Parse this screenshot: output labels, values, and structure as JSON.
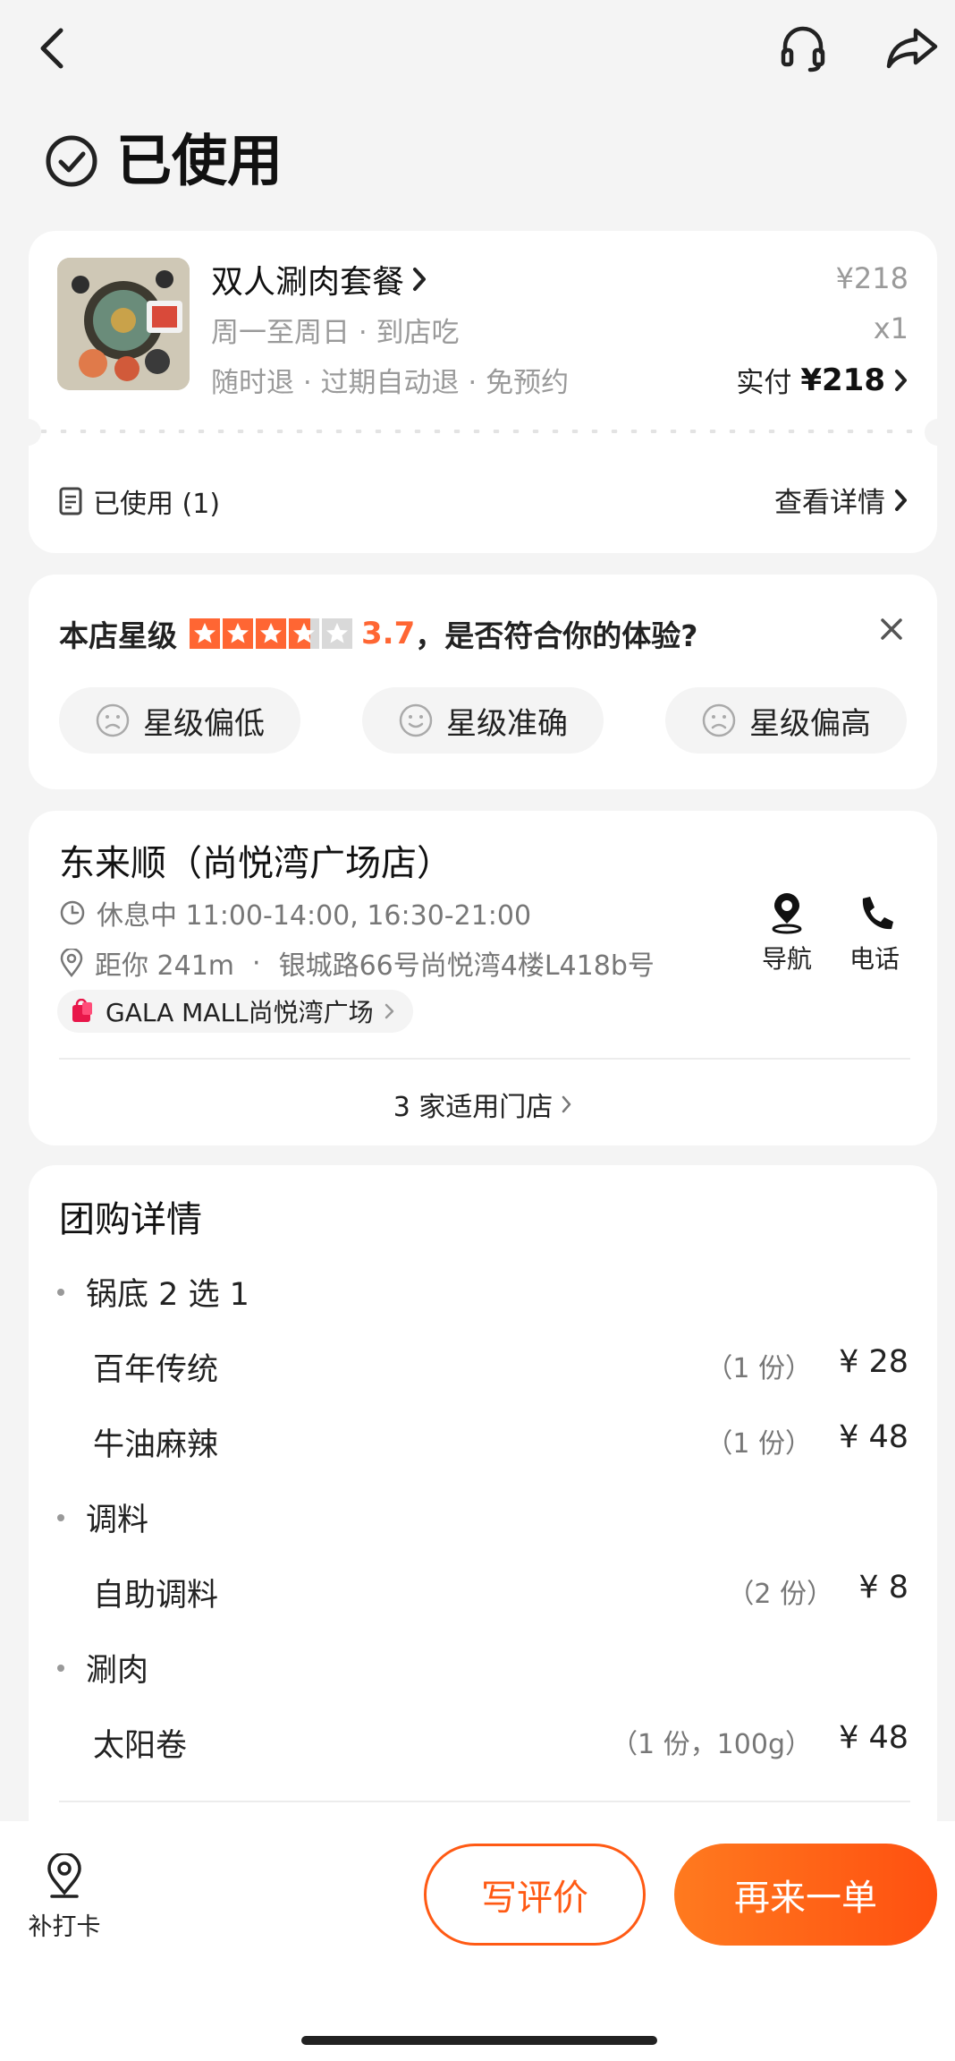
{
  "header": {
    "status_label": "已使用"
  },
  "order": {
    "title": "双人涮肉套餐",
    "subtitle": "周一至周日 · 到店吃",
    "policy": "随时退 · 过期自动退 · 免预约",
    "price": "¥218",
    "quantity": "x1",
    "paid_label": "实付",
    "paid_amount": "¥218",
    "voucher_status": "已使用 (1)",
    "view_details": "查看详情"
  },
  "rating": {
    "prefix": "本店星级",
    "score": "3.7",
    "stars_value": 3.7,
    "question": "，是否符合你的体验?",
    "options": [
      "星级偏低",
      "星级准确",
      "星级偏高"
    ]
  },
  "store": {
    "name": "东来顺（尚悦湾广场店）",
    "hours": "休息中 11:00-14:00, 16:30-21:00",
    "distance": "距你 241m",
    "address": "银城路66号尚悦湾4楼L418b号",
    "mall": "GALA MALL尚悦湾广场",
    "nav_label": "导航",
    "phone_label": "电话",
    "applicable_stores": "3 家适用门店"
  },
  "deal": {
    "title": "团购详情",
    "groups": [
      {
        "name": "锅底 2 选 1",
        "items": [
          {
            "name": "百年传统",
            "qty": "（1 份）",
            "price": "¥ 28"
          },
          {
            "name": "牛油麻辣",
            "qty": "（1 份）",
            "price": "¥ 48"
          }
        ]
      },
      {
        "name": "调料",
        "items": [
          {
            "name": "自助调料",
            "qty": "（2 份）",
            "price": "¥ 8"
          }
        ]
      },
      {
        "name": "涮肉",
        "items": [
          {
            "name": "太阳卷",
            "qty": "（1 份，100g）",
            "price": "¥ 48"
          }
        ]
      }
    ]
  },
  "bottom": {
    "checkin_label": "补打卡",
    "review_button": "写评价",
    "reorder_button": "再来一单"
  },
  "colors": {
    "accent": "#ff5a14",
    "accent_gradient_start": "#ff6a1f",
    "star_filled": "#ff6633",
    "star_empty": "#d9d9d9",
    "background": "#f4f4f4"
  }
}
